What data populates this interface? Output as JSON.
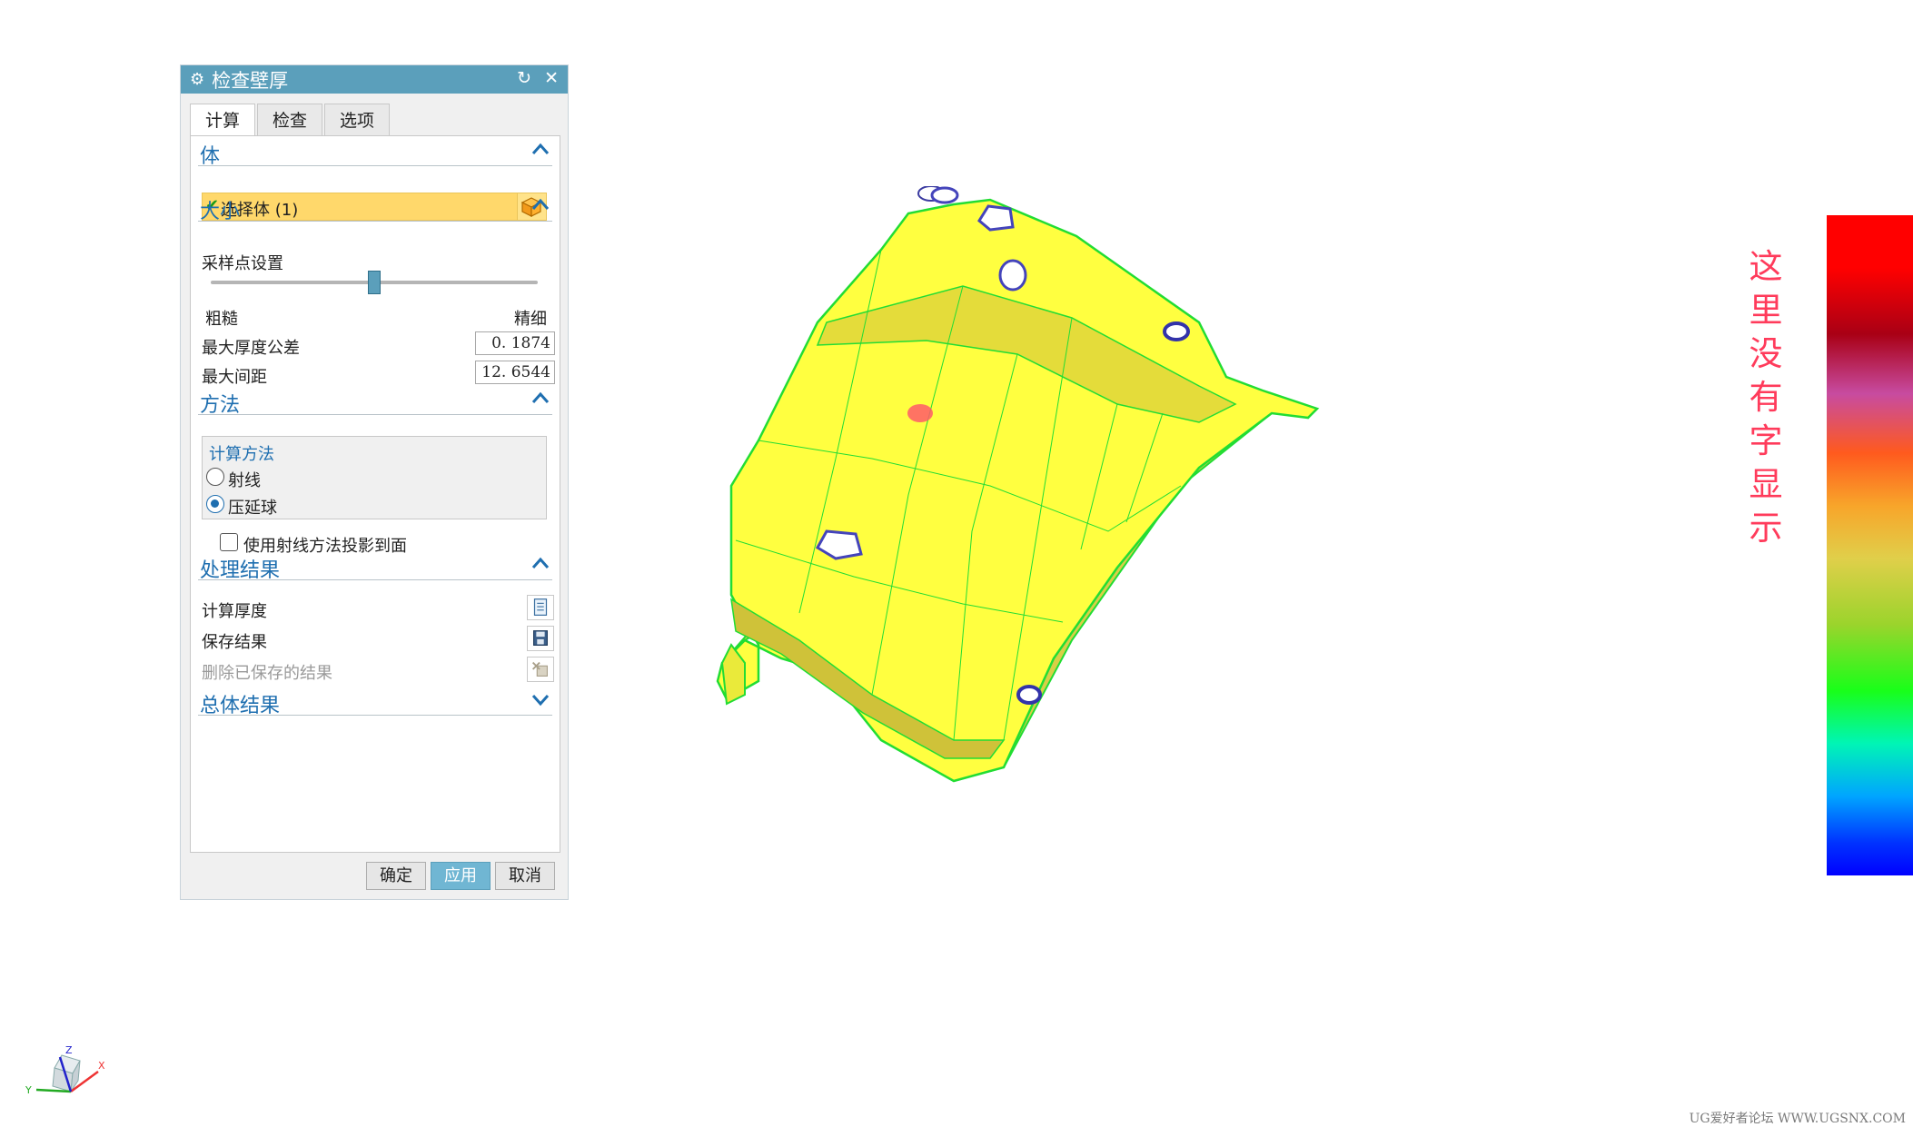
{
  "dialog": {
    "title": "检查壁厚",
    "icons": {
      "gear": "gear-icon",
      "reset": "reset-icon",
      "close": "close-icon"
    },
    "tabs": [
      {
        "label": "计算",
        "active": true
      },
      {
        "label": "检查",
        "active": false
      },
      {
        "label": "选项",
        "active": false
      }
    ],
    "body_section": {
      "title": "体",
      "select_label": "选择体 (1)",
      "icon": "cube-icon"
    },
    "size_section": {
      "title": "大小",
      "sample_label": "采样点设置",
      "slider_min_label": "粗糙",
      "slider_max_label": "精细",
      "slider_value": 0.5,
      "max_thickness_tolerance_label": "最大厚度公差",
      "max_thickness_tolerance_value": "0. 1874",
      "max_distance_label": "最大间距",
      "max_distance_value": "12. 6544"
    },
    "method_section": {
      "title": "方法",
      "group_title": "计算方法",
      "options": [
        {
          "label": "射线",
          "selected": false
        },
        {
          "label": "压延球",
          "selected": true
        }
      ],
      "project_checkbox_label": "使用射线方法投影到面",
      "project_checked": false
    },
    "results_section": {
      "title": "处理结果",
      "items": [
        {
          "label": "计算厚度",
          "icon": "document-icon",
          "enabled": true
        },
        {
          "label": "保存结果",
          "icon": "save-icon",
          "enabled": true
        },
        {
          "label": "删除已保存的结果",
          "icon": "delete-results-icon",
          "enabled": false
        }
      ]
    },
    "summary_section": {
      "title": "总体结果"
    },
    "buttons": {
      "ok": "确定",
      "apply": "应用",
      "cancel": "取消"
    }
  },
  "annotation_note": "这里没有字显示",
  "triad_labels": {
    "x": "X",
    "y": "Y",
    "z": "Z"
  },
  "watermark": "UG爱好者论坛 WWW.UGSNX.COM",
  "colors": {
    "title_bar": "#5b9fbb",
    "section_title": "#1f6fb0",
    "selection_highlight": "#ffd86b",
    "model_surface": "#ffff40",
    "model_edges": "#22dd33",
    "note_text": "#ff3b5b"
  }
}
